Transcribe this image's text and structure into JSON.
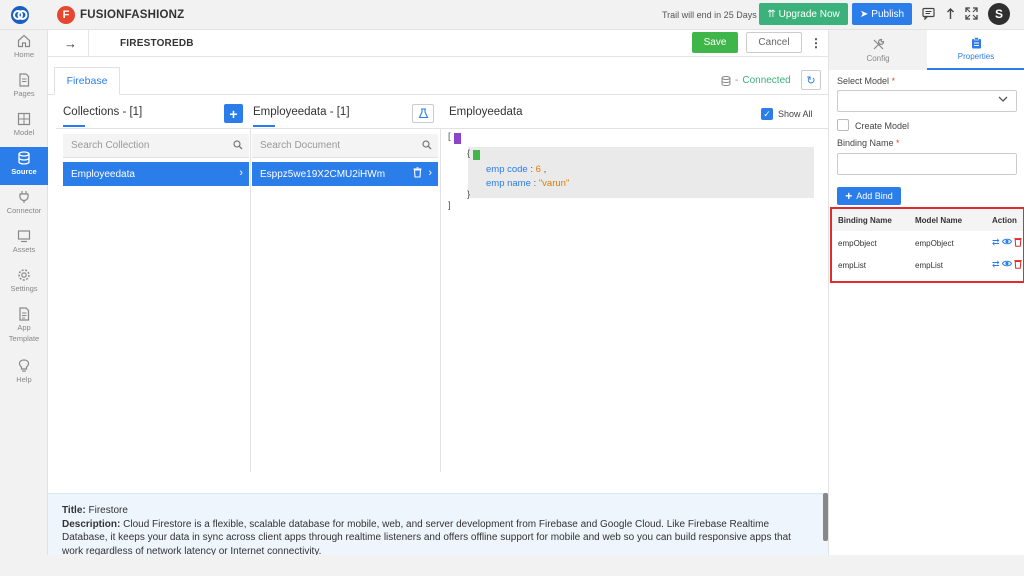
{
  "topbar": {
    "brand_letter": "F",
    "brand_name": "FUSIONFASHIONZ",
    "trial_text": "Trail will end in 25 Days",
    "upgrade_label": "Upgrade Now",
    "publish_label": "Publish",
    "avatar_letter": "S"
  },
  "sidebar": {
    "items": [
      {
        "label": "Home",
        "icon": "home-icon"
      },
      {
        "label": "Pages",
        "icon": "pages-icon"
      },
      {
        "label": "Model",
        "icon": "model-icon"
      },
      {
        "label": "Source",
        "icon": "database-icon",
        "active": true
      },
      {
        "label": "Connector",
        "icon": "plug-icon"
      },
      {
        "label": "Assets",
        "icon": "monitor-icon"
      },
      {
        "label": "Settings",
        "icon": "gear-icon"
      },
      {
        "label": "App",
        "label2": "Template",
        "icon": "template-icon"
      },
      {
        "label": "Help",
        "icon": "bulb-icon"
      }
    ]
  },
  "header": {
    "title": "FIRESTOREDB",
    "save_label": "Save",
    "cancel_label": "Cancel"
  },
  "tabs": {
    "firebase_label": "Firebase",
    "connection_status": "Connected"
  },
  "collections": {
    "title": "Collections - [1]",
    "search_placeholder": "Search Collection",
    "items": [
      "Employeedata"
    ]
  },
  "documents": {
    "title": "Employeedata - [1]",
    "search_placeholder": "Search Document",
    "items": [
      "Esppz5we19X2CMU2iHWm"
    ]
  },
  "viewer": {
    "title": "Employeedata",
    "show_all_label": "Show All",
    "open_bracket": "[",
    "close_bracket": "]",
    "open_brace": "{",
    "close_brace": "}",
    "fields": [
      {
        "key": "emp code",
        "value": "6",
        "sep": " : ",
        "trail": " ,"
      },
      {
        "key": "emp name",
        "value": "\"varun\"",
        "sep": " : ",
        "trail": ""
      }
    ]
  },
  "footer": {
    "title_label": "Title:",
    "title_value": " Firestore",
    "desc_label": "Description:",
    "desc_value": " Cloud Firestore is a flexible, scalable database for mobile, web, and server development from Firebase and Google Cloud. Like Firebase Realtime Database, it keeps your data in sync across client apps through realtime listeners and offers offline support for mobile and web so you can build responsive apps that work regardless of network latency or Internet connectivity."
  },
  "right_panel": {
    "tab_config": "Config",
    "tab_properties": "Properties",
    "select_model_label": "Select Model",
    "required_mark": "*",
    "create_model_label": "Create Model",
    "binding_name_label": "Binding Name",
    "add_bind_label": "Add Bind",
    "table": {
      "headers": [
        "Binding Name",
        "Model Name",
        "Action"
      ],
      "rows": [
        {
          "binding": "empObject",
          "model": "empObject"
        },
        {
          "binding": "empList",
          "model": "empList"
        }
      ]
    }
  },
  "colors": {
    "accent": "#2b7de9",
    "success": "#3bb27b",
    "save": "#3fb649",
    "brand": "#e8472f",
    "highlight_border": "#e22b2b"
  }
}
